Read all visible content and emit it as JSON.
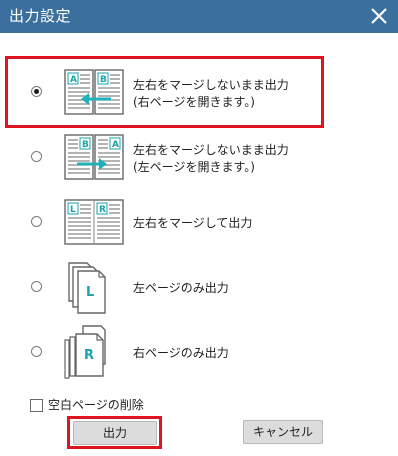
{
  "window": {
    "title": "出力設定"
  },
  "options": [
    {
      "line1": "左右をマージしないまま出力",
      "line2": "(右ページを開きます。)",
      "selected": true,
      "icon": "merge-none-right-icon"
    },
    {
      "line1": "左右をマージしないまま出力",
      "line2": "(左ページを開きます。)",
      "selected": false,
      "icon": "merge-none-left-icon"
    },
    {
      "line1": "左右をマージして出力",
      "selected": false,
      "icon": "merge-pages-icon"
    },
    {
      "line1": "左ページのみ出力",
      "selected": false,
      "icon": "left-page-only-icon"
    },
    {
      "line1": "右ページのみ出力",
      "selected": false,
      "icon": "right-page-only-icon"
    }
  ],
  "delete_blank": {
    "label": "空白ページの削除",
    "checked": false
  },
  "buttons": {
    "ok": "出力",
    "cancel": "キャンセル"
  },
  "colors": {
    "titlebar": "#3a6f9e",
    "accent": "#20b2b8",
    "highlight": "#e0141f"
  }
}
